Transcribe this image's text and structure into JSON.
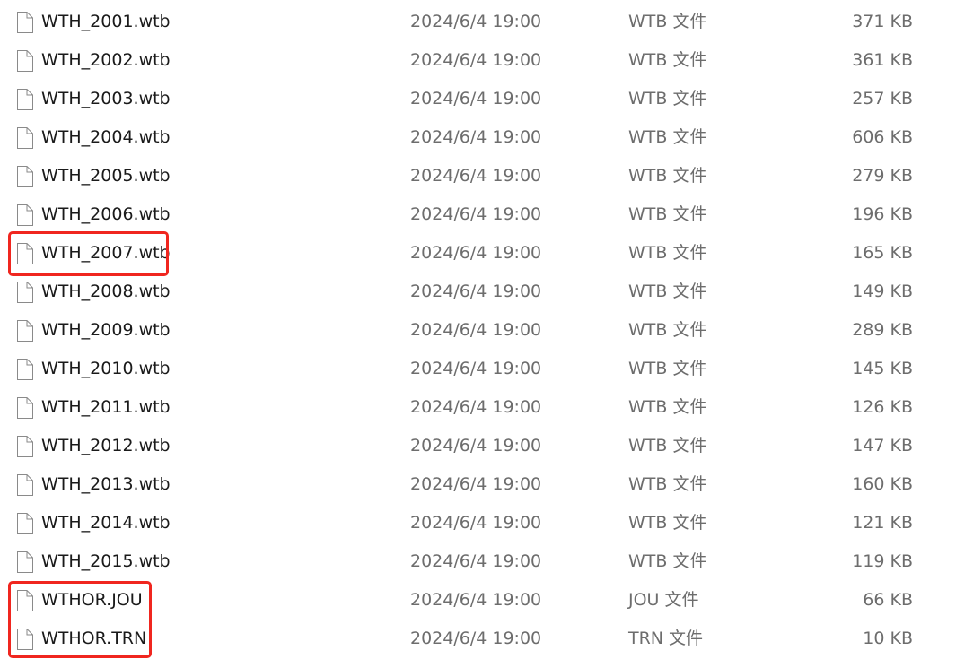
{
  "highlight_color": "#f0261f",
  "files": [
    {
      "name": "WTH_2001.wtb",
      "modified": "2024/6/4 19:00",
      "type": "WTB 文件",
      "size": "371 KB",
      "icon": "file-icon"
    },
    {
      "name": "WTH_2002.wtb",
      "modified": "2024/6/4 19:00",
      "type": "WTB 文件",
      "size": "361 KB",
      "icon": "file-icon"
    },
    {
      "name": "WTH_2003.wtb",
      "modified": "2024/6/4 19:00",
      "type": "WTB 文件",
      "size": "257 KB",
      "icon": "file-icon"
    },
    {
      "name": "WTH_2004.wtb",
      "modified": "2024/6/4 19:00",
      "type": "WTB 文件",
      "size": "606 KB",
      "icon": "file-icon"
    },
    {
      "name": "WTH_2005.wtb",
      "modified": "2024/6/4 19:00",
      "type": "WTB 文件",
      "size": "279 KB",
      "icon": "file-icon"
    },
    {
      "name": "WTH_2006.wtb",
      "modified": "2024/6/4 19:00",
      "type": "WTB 文件",
      "size": "196 KB",
      "icon": "file-icon"
    },
    {
      "name": "WTH_2007.wtb",
      "modified": "2024/6/4 19:00",
      "type": "WTB 文件",
      "size": "165 KB",
      "icon": "file-icon"
    },
    {
      "name": "WTH_2008.wtb",
      "modified": "2024/6/4 19:00",
      "type": "WTB 文件",
      "size": "149 KB",
      "icon": "file-icon"
    },
    {
      "name": "WTH_2009.wtb",
      "modified": "2024/6/4 19:00",
      "type": "WTB 文件",
      "size": "289 KB",
      "icon": "file-icon"
    },
    {
      "name": "WTH_2010.wtb",
      "modified": "2024/6/4 19:00",
      "type": "WTB 文件",
      "size": "145 KB",
      "icon": "file-icon"
    },
    {
      "name": "WTH_2011.wtb",
      "modified": "2024/6/4 19:00",
      "type": "WTB 文件",
      "size": "126 KB",
      "icon": "file-icon"
    },
    {
      "name": "WTH_2012.wtb",
      "modified": "2024/6/4 19:00",
      "type": "WTB 文件",
      "size": "147 KB",
      "icon": "file-icon"
    },
    {
      "name": "WTH_2013.wtb",
      "modified": "2024/6/4 19:00",
      "type": "WTB 文件",
      "size": "160 KB",
      "icon": "file-icon"
    },
    {
      "name": "WTH_2014.wtb",
      "modified": "2024/6/4 19:00",
      "type": "WTB 文件",
      "size": "121 KB",
      "icon": "file-icon"
    },
    {
      "name": "WTH_2015.wtb",
      "modified": "2024/6/4 19:00",
      "type": "WTB 文件",
      "size": "119 KB",
      "icon": "file-icon"
    },
    {
      "name": "WTHOR.JOU",
      "modified": "2024/6/4 19:00",
      "type": "JOU 文件",
      "size": "66 KB",
      "icon": "file-icon"
    },
    {
      "name": "WTHOR.TRN",
      "modified": "2024/6/4 19:00",
      "type": "TRN 文件",
      "size": "10 KB",
      "icon": "file-icon"
    }
  ]
}
